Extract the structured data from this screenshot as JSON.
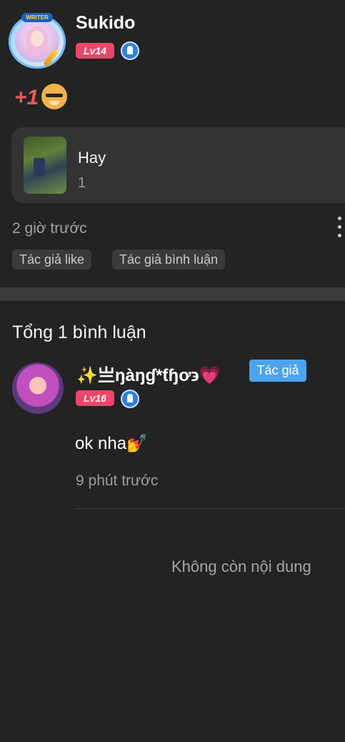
{
  "post": {
    "author": "Sukido",
    "level": "Lv14",
    "avatar_badge": "WRITER",
    "reaction": "+1",
    "reaction_emoji": "doge-emoji",
    "card": {
      "title": "Hay",
      "subtitle": "1"
    },
    "time": "2 giờ trước",
    "tags": [
      "Tác giả like",
      "Tác giả bình luận"
    ]
  },
  "comments": {
    "heading": "Tổng 1 bình luận",
    "items": [
      {
        "name": "✨亗ŋàŋɠ*ƭɧơ϶💗",
        "author_badge": "Tác giả",
        "level": "Lv16",
        "text": "ok nha💅",
        "time": "9 phút trước"
      }
    ]
  },
  "footer": {
    "end_text": "Không còn nội dung"
  },
  "colors": {
    "background": "#232323",
    "card": "#333333",
    "level_badge": "#f0456a",
    "author_badge": "#4ea3ee",
    "verified": "#2f7fe0"
  }
}
